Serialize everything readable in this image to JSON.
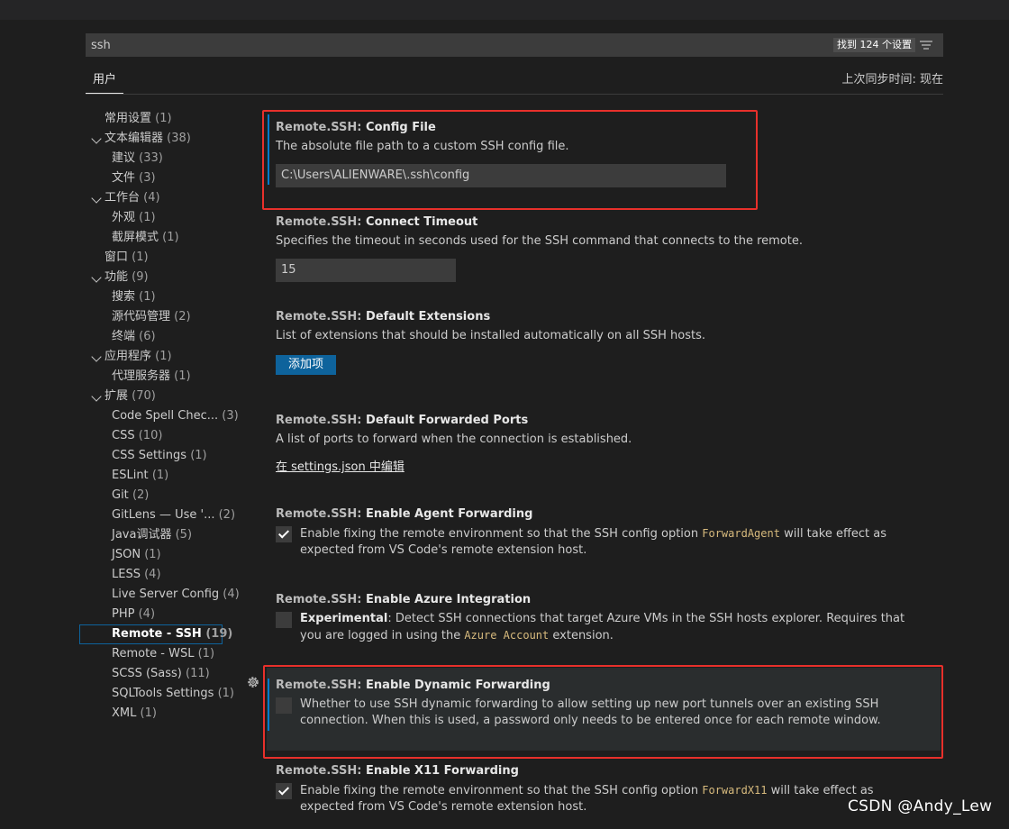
{
  "search": {
    "value": "ssh",
    "result_count": "找到 124 个设置",
    "filter_icon": "filter-list-icon"
  },
  "tabs": {
    "user": "用户",
    "sync_status": "上次同步时间: 现在"
  },
  "toc": [
    {
      "label": "常用设置",
      "count": "(1)",
      "level": 0,
      "chevron": false
    },
    {
      "label": "文本编辑器",
      "count": "(38)",
      "level": 0,
      "chevron": true
    },
    {
      "label": "建议",
      "count": "(33)",
      "level": 1,
      "chevron": false
    },
    {
      "label": "文件",
      "count": "(3)",
      "level": 1,
      "chevron": false
    },
    {
      "label": "工作台",
      "count": "(4)",
      "level": 0,
      "chevron": true
    },
    {
      "label": "外观",
      "count": "(1)",
      "level": 1,
      "chevron": false
    },
    {
      "label": "截屏模式",
      "count": "(1)",
      "level": 1,
      "chevron": false
    },
    {
      "label": "窗口",
      "count": "(1)",
      "level": 0,
      "chevron": false
    },
    {
      "label": "功能",
      "count": "(9)",
      "level": 0,
      "chevron": true
    },
    {
      "label": "搜索",
      "count": "(1)",
      "level": 1,
      "chevron": false
    },
    {
      "label": "源代码管理",
      "count": "(2)",
      "level": 1,
      "chevron": false
    },
    {
      "label": "终端",
      "count": "(6)",
      "level": 1,
      "chevron": false
    },
    {
      "label": "应用程序",
      "count": "(1)",
      "level": 0,
      "chevron": true
    },
    {
      "label": "代理服务器",
      "count": "(1)",
      "level": 1,
      "chevron": false
    },
    {
      "label": "扩展",
      "count": "(70)",
      "level": 0,
      "chevron": true
    },
    {
      "label": "Code Spell Chec...",
      "count": "(3)",
      "level": 1,
      "chevron": false
    },
    {
      "label": "CSS",
      "count": "(10)",
      "level": 1,
      "chevron": false
    },
    {
      "label": "CSS Settings",
      "count": "(1)",
      "level": 1,
      "chevron": false
    },
    {
      "label": "ESLint",
      "count": "(1)",
      "level": 1,
      "chevron": false
    },
    {
      "label": "Git",
      "count": "(2)",
      "level": 1,
      "chevron": false
    },
    {
      "label": "GitLens — Use '...",
      "count": "(2)",
      "level": 1,
      "chevron": false
    },
    {
      "label": "Java调试器",
      "count": "(5)",
      "level": 1,
      "chevron": false
    },
    {
      "label": "JSON",
      "count": "(1)",
      "level": 1,
      "chevron": false
    },
    {
      "label": "LESS",
      "count": "(4)",
      "level": 1,
      "chevron": false
    },
    {
      "label": "Live Server Config",
      "count": "(4)",
      "level": 1,
      "chevron": false
    },
    {
      "label": "PHP",
      "count": "(4)",
      "level": 1,
      "chevron": false
    },
    {
      "label": "Remote - SSH",
      "count": "(19)",
      "level": 1,
      "chevron": false,
      "selected": true
    },
    {
      "label": "Remote - WSL",
      "count": "(1)",
      "level": 1,
      "chevron": false
    },
    {
      "label": "SCSS (Sass)",
      "count": "(11)",
      "level": 1,
      "chevron": false
    },
    {
      "label": "SQLTools Settings",
      "count": "(1)",
      "level": 1,
      "chevron": false
    },
    {
      "label": "XML",
      "count": "(1)",
      "level": 1,
      "chevron": false
    }
  ],
  "settings": {
    "config_file": {
      "category": "Remote.SSH: ",
      "name": "Config File",
      "description": "The absolute file path to a custom SSH config file.",
      "value": "C:\\Users\\ALIENWARE\\.ssh\\config"
    },
    "connect_timeout": {
      "category": "Remote.SSH: ",
      "name": "Connect Timeout",
      "description": "Specifies the timeout in seconds used for the SSH command that connects to the remote.",
      "value": "15"
    },
    "default_extensions": {
      "category": "Remote.SSH: ",
      "name": "Default Extensions",
      "description": "List of extensions that should be installed automatically on all SSH hosts.",
      "button_label": "添加项"
    },
    "default_forwarded_ports": {
      "category": "Remote.SSH: ",
      "name": "Default Forwarded Ports",
      "description": "A list of ports to forward when the connection is established.",
      "link_label": "在 settings.json 中编辑"
    },
    "agent_forwarding": {
      "category": "Remote.SSH: ",
      "name": "Enable Agent Forwarding",
      "checked": true,
      "desc_pre": "Enable fixing the remote environment so that the SSH config option ",
      "desc_code": "ForwardAgent",
      "desc_post": " will take effect as expected from VS Code's remote extension host."
    },
    "azure_integration": {
      "category": "Remote.SSH: ",
      "name": "Enable Azure Integration",
      "checked": false,
      "desc_bold": "Experimental",
      "desc_pre": ": Detect SSH connections that target Azure VMs in the SSH hosts explorer. Requires that you are logged in using the ",
      "desc_code": "Azure Account",
      "desc_post": " extension."
    },
    "dynamic_forwarding": {
      "category": "Remote.SSH: ",
      "name": "Enable Dynamic Forwarding",
      "checked": false,
      "description": "Whether to use SSH dynamic forwarding to allow setting up new port tunnels over an existing SSH connection. When this is used, a password only needs to be entered once for each remote window."
    },
    "x11_forwarding": {
      "category": "Remote.SSH: ",
      "name": "Enable X11 Forwarding",
      "checked": true,
      "desc_pre": "Enable fixing the remote environment so that the SSH config option ",
      "desc_code": "ForwardX11",
      "desc_post": " will take effect as expected from VS Code's remote extension host."
    }
  },
  "watermark": "CSDN @Andy_Lew",
  "colors": {
    "background": "#1e1e1e",
    "accent": "#007acc",
    "button": "#0e639c",
    "highlight_box": "#e8302b",
    "code": "#d7ba7d"
  }
}
